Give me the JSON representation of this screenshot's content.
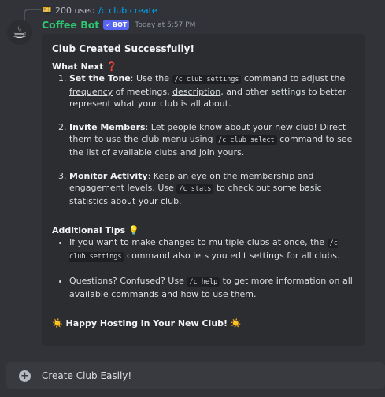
{
  "reply": {
    "avatar_emoji": "🎫",
    "used_text": "200 used",
    "command": "/c club create"
  },
  "message": {
    "avatar_emoji": "☕",
    "username": "Coffee Bot",
    "bot_tag": "BOT",
    "bot_check": "✓",
    "timestamp": "Today at 5:57 PM"
  },
  "embed": {
    "title": "Club Created Successfully!",
    "what_next": {
      "heading": "What Next",
      "emoji": "❓"
    },
    "steps": [
      {
        "title": "Set the Tone",
        "t1": ": Use the ",
        "code": "/c club settings",
        "t2": " command to adjust the ",
        "link1": "frequency",
        "t3": " of meetings, ",
        "link2": "description",
        "t4": ", and other settings to better represent what your club is all about."
      },
      {
        "title": "Invite Members",
        "t1": ": Let people know about your new club! Direct them to use the club menu using ",
        "code": "/c club select",
        "t2": " command to see the list of available clubs and join yours."
      },
      {
        "title": "Monitor Activity",
        "t1": ": Keep an eye on the membership and engagement levels. Use ",
        "code": "/c stats",
        "t2": " to check out some basic statistics about your club."
      }
    ],
    "tips": {
      "heading": "Additional Tips",
      "emoji": "💡"
    },
    "tip_items": [
      {
        "t1": "If you want to make changes to multiple clubs at once, the ",
        "code": "/c club settings",
        "t2": " command also lets you edit settings for all clubs."
      },
      {
        "t1": "Questions? Confused? Use ",
        "code": "/c help",
        "t2": " to get more information on all available commands and how to use them."
      }
    ],
    "footer": {
      "emoji": "☀️",
      "text": "Happy Hosting in Your New Club!"
    }
  },
  "composer": {
    "plus_label": "+",
    "placeholder": "Create Club Easily!"
  },
  "colors": {
    "background": "#313338",
    "embed": "#2b2d31",
    "username": "#2dc770",
    "link": "#00a8fc",
    "bot_tag": "#5865f2"
  }
}
